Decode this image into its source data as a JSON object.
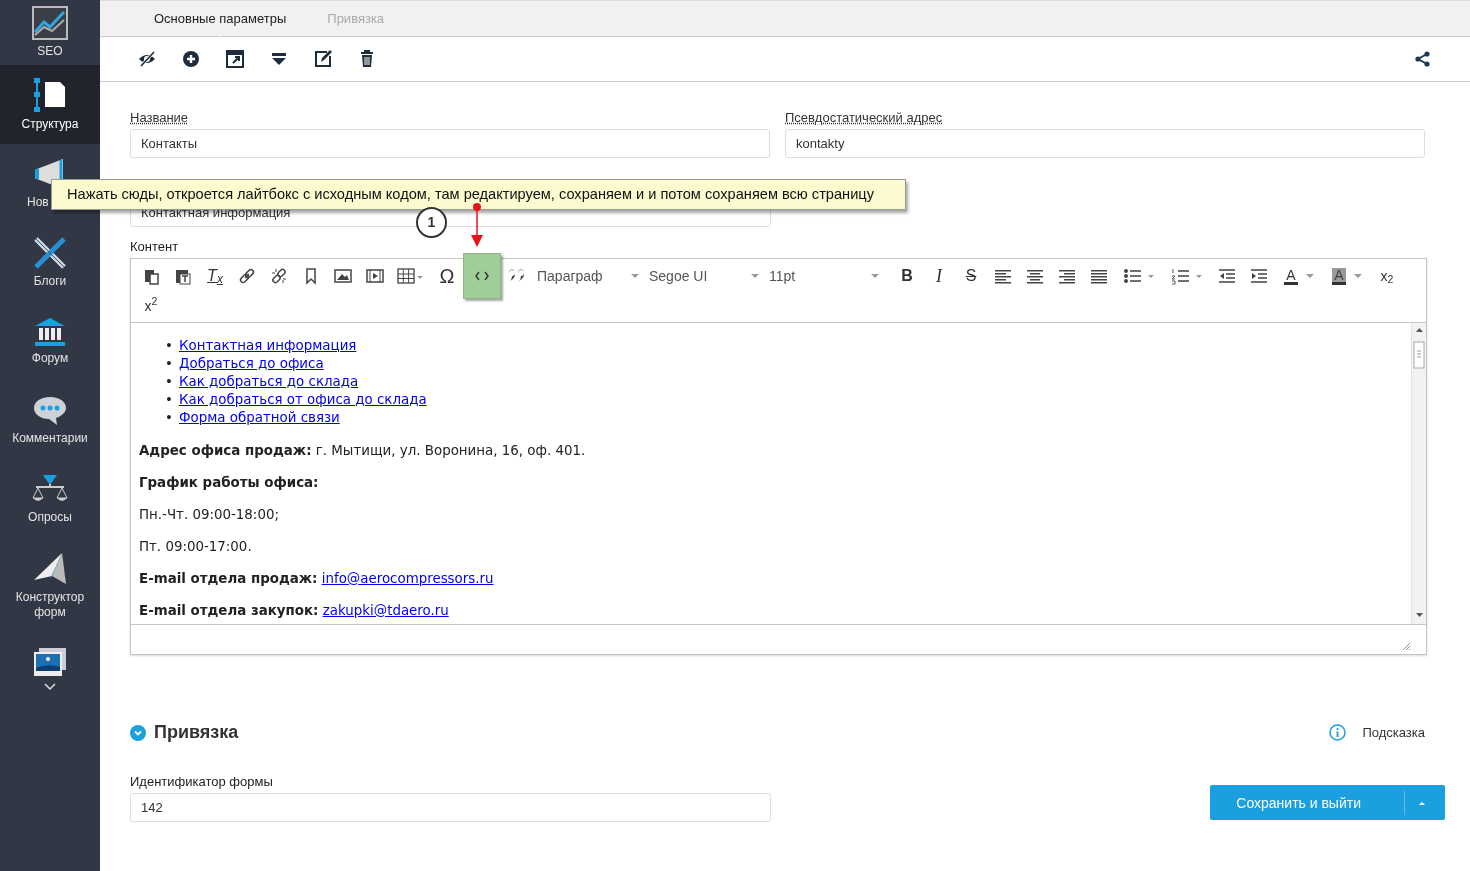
{
  "sidebar": {
    "items": [
      {
        "label": "SEO",
        "selected": false
      },
      {
        "label": "Структура",
        "selected": true
      },
      {
        "label": "Нов",
        "selected": false
      },
      {
        "label": "Блоги",
        "selected": false
      },
      {
        "label": "Форум",
        "selected": false
      },
      {
        "label": "Комментарии",
        "selected": false
      },
      {
        "label": "Опросы",
        "selected": false
      },
      {
        "label": "Конструктор форм",
        "selected": false
      }
    ]
  },
  "tabs": [
    {
      "label": "Основные параметры",
      "selected": true
    },
    {
      "label": "Привязка",
      "selected": false
    }
  ],
  "fields": [
    {
      "label": "Название",
      "value": "Контакты"
    },
    {
      "label": "Псевдостатический адрес",
      "value": "kontakty"
    }
  ],
  "covered_field": {
    "value": "Контактная информация"
  },
  "editor": {
    "label": "Контент",
    "symbol_button": "Ω",
    "source_button": {
      "highlighted": true
    },
    "block_format": "Параграф",
    "font_family": "Segoe UI",
    "font_size": "11pt",
    "clear_format": "T$_{x}$",
    "bold": "B",
    "italic": "I",
    "strike": "S",
    "text_color": "A",
    "background_color": "A",
    "subscript": "x$_{2}$",
    "superscript": "x$^{2}$",
    "content": {
      "marker": "•",
      "links": [
        "Контактная информация",
        "Добраться до офиса",
        "Как добраться до склада",
        "Как добраться от офиса до склада",
        "Форма обратной связи"
      ],
      "paragraphs": [
        {
          "kind": "text",
          "text": "**Адрес офиса продаж:** г. Мытищи, ул. Воронина, 16, оф. 401."
        },
        {
          "kind": "heading",
          "text": "График работы офиса:"
        },
        {
          "kind": "text",
          "text": "Пн.-Чт. 09:00-18:00;"
        },
        {
          "kind": "text",
          "text": "Пт. 09:00-17:00."
        },
        {
          "kind": "email",
          "label": "E-mail отдела продаж:",
          "link": "info@aerocompressors.ru"
        },
        {
          "kind": "email",
          "label": "E-mail отдела закупок:",
          "link": "zakupki@tdaero.ru"
        }
      ]
    }
  },
  "callout": {
    "text": "Нажать сюды, откроется лайтбокс с исходным кодом, там редактируем, сохраняем и и потом сохраняем всю страницу",
    "step": "1"
  },
  "section": {
    "title": "Привязка",
    "expanded": true,
    "hint": "Подсказка",
    "field": {
      "label": "Идентификатор формы",
      "value": "142"
    }
  },
  "save_button": {
    "label": "Сохранить и выйти"
  }
}
